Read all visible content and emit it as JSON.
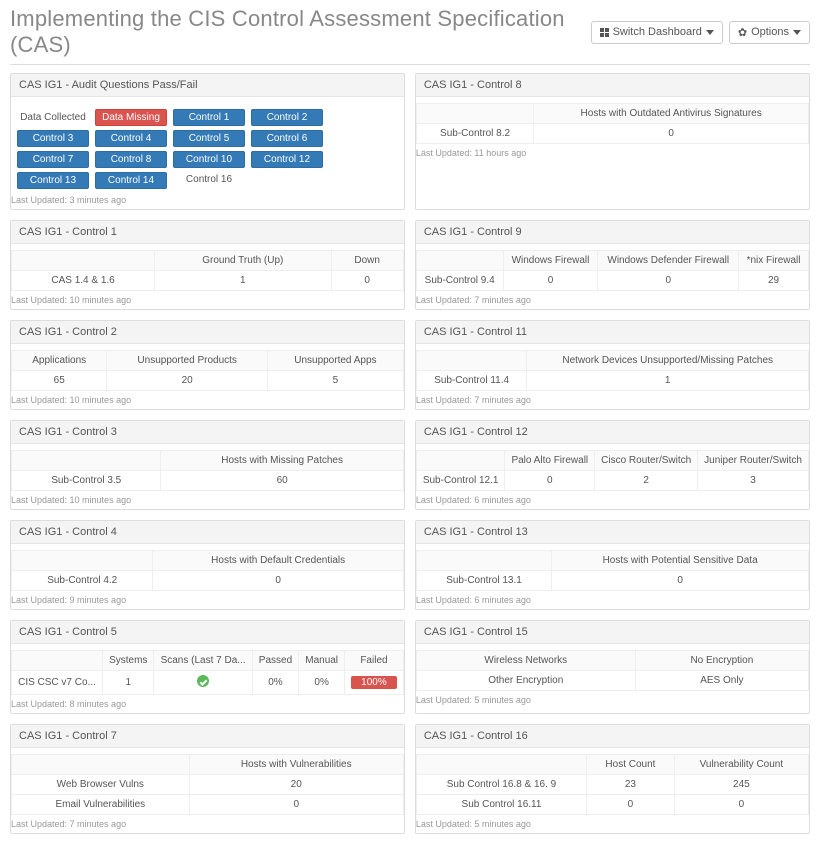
{
  "header": {
    "title": "Implementing the CIS Control Assessment Specification (CAS)",
    "switch_dashboard": "Switch Dashboard",
    "options": "Options"
  },
  "panels": {
    "audit": {
      "title": "CAS IG1 - Audit Questions Pass/Fail",
      "footer": "Last Updated: 3 minutes ago",
      "chips": [
        {
          "label": "Data Collected",
          "style": "plain"
        },
        {
          "label": "Data Missing",
          "style": "red"
        },
        {
          "label": "Control 1",
          "style": "blue"
        },
        {
          "label": "Control 2",
          "style": "blue"
        },
        {
          "label": "Control 3",
          "style": "blue"
        },
        {
          "label": "Control 4",
          "style": "blue"
        },
        {
          "label": "Control 5",
          "style": "blue"
        },
        {
          "label": "Control 6",
          "style": "blue"
        },
        {
          "label": "Control 7",
          "style": "blue"
        },
        {
          "label": "Control 8",
          "style": "blue"
        },
        {
          "label": "Control 10",
          "style": "blue"
        },
        {
          "label": "Control 12",
          "style": "blue"
        },
        {
          "label": "Control 13",
          "style": "blue"
        },
        {
          "label": "Control 14",
          "style": "blue"
        },
        {
          "label": "Control 16",
          "style": "white"
        }
      ]
    },
    "c8": {
      "title": "CAS IG1 - Control 8",
      "footer": "Last Updated: 11 hours ago",
      "cols": [
        "",
        "Hosts with Outdated Antivirus Signatures"
      ],
      "rows": [
        [
          "Sub-Control 8.2",
          "0"
        ]
      ]
    },
    "c1": {
      "title": "CAS IG1 - Control 1",
      "footer": "Last Updated: 10 minutes ago",
      "cols": [
        "",
        "Ground Truth (Up)",
        "Down"
      ],
      "rows": [
        [
          "CAS 1.4 & 1.6",
          "1",
          "0"
        ]
      ]
    },
    "c9": {
      "title": "CAS IG1 - Control 9",
      "footer": "Last Updated: 7 minutes ago",
      "cols": [
        "",
        "Windows Firewall",
        "Windows Defender Firewall",
        "*nix Firewall"
      ],
      "rows": [
        [
          "Sub-Control 9.4",
          "0",
          "0",
          "29"
        ]
      ]
    },
    "c2": {
      "title": "CAS IG1 - Control 2",
      "footer": "Last Updated: 10 minutes ago",
      "cols": [
        "Applications",
        "Unsupported Products",
        "Unsupported Apps"
      ],
      "rows": [
        [
          "65",
          "20",
          "5"
        ]
      ]
    },
    "c11": {
      "title": "CAS IG1 - Control 11",
      "footer": "Last Updated: 7 minutes ago",
      "cols": [
        "",
        "Network Devices Unsupported/Missing Patches"
      ],
      "rows": [
        [
          "Sub-Control 11.4",
          "1"
        ]
      ]
    },
    "c3": {
      "title": "CAS IG1 - Control 3",
      "footer": "Last Updated: 10 minutes ago",
      "cols": [
        "",
        "Hosts with Missing Patches"
      ],
      "rows": [
        [
          "Sub-Control 3.5",
          "60"
        ]
      ]
    },
    "c12": {
      "title": "CAS IG1 - Control 12",
      "footer": "Last Updated: 6 minutes ago",
      "cols": [
        "",
        "Palo Alto Firewall",
        "Cisco Router/Switch",
        "Juniper Router/Switch"
      ],
      "rows": [
        [
          "Sub-Control 12.1",
          "0",
          "2",
          "3"
        ]
      ]
    },
    "c4": {
      "title": "CAS IG1 - Control 4",
      "footer": "Last Updated: 9 minutes ago",
      "cols": [
        "",
        "Hosts with Default Credentials"
      ],
      "rows": [
        [
          "Sub-Control 4.2",
          "0"
        ]
      ]
    },
    "c13": {
      "title": "CAS IG1 - Control 13",
      "footer": "Last Updated: 6 minutes ago",
      "cols": [
        "",
        "Hosts with Potential Sensitive Data"
      ],
      "rows": [
        [
          "Sub-Control 13.1",
          "0"
        ]
      ]
    },
    "c5": {
      "title": "CAS IG1 - Control 5",
      "footer": "Last Updated: 8 minutes ago",
      "cols": [
        "",
        "Systems",
        "Scans (Last 7 Da...",
        "Passed",
        "Manual",
        "Failed"
      ],
      "rows": [
        [
          "CIS CSC v7 Co...",
          "1",
          "__CHECK__",
          "0%",
          "0%",
          "__RED__100%"
        ]
      ]
    },
    "c15": {
      "title": "CAS IG1 - Control 15",
      "footer": "Last Updated: 5 minutes ago",
      "cols": [
        "Wireless Networks",
        "No Encryption"
      ],
      "rows": [
        [
          "Other Encryption",
          "AES Only"
        ]
      ]
    },
    "c7": {
      "title": "CAS IG1 - Control 7",
      "footer": "Last Updated: 7 minutes ago",
      "cols": [
        "",
        "Hosts with Vulnerabilities"
      ],
      "rows": [
        [
          "Web Browser Vulns",
          "20"
        ],
        [
          "Email Vulnerabilities",
          "0"
        ]
      ]
    },
    "c16": {
      "title": "CAS IG1 - Control 16",
      "footer": "Last Updated: 5 minutes ago",
      "cols": [
        "",
        "Host Count",
        "Vulnerability Count"
      ],
      "rows": [
        [
          "Sub Control 16.8 & 16. 9",
          "23",
          "245"
        ],
        [
          "Sub Control 16.11",
          "0",
          "0"
        ]
      ]
    }
  },
  "layout": [
    "audit",
    "c8",
    "c1",
    "c9",
    "c2",
    "c11",
    "c3",
    "c12",
    "c4",
    "c13",
    "c5",
    "c15",
    "c7",
    "c16"
  ]
}
